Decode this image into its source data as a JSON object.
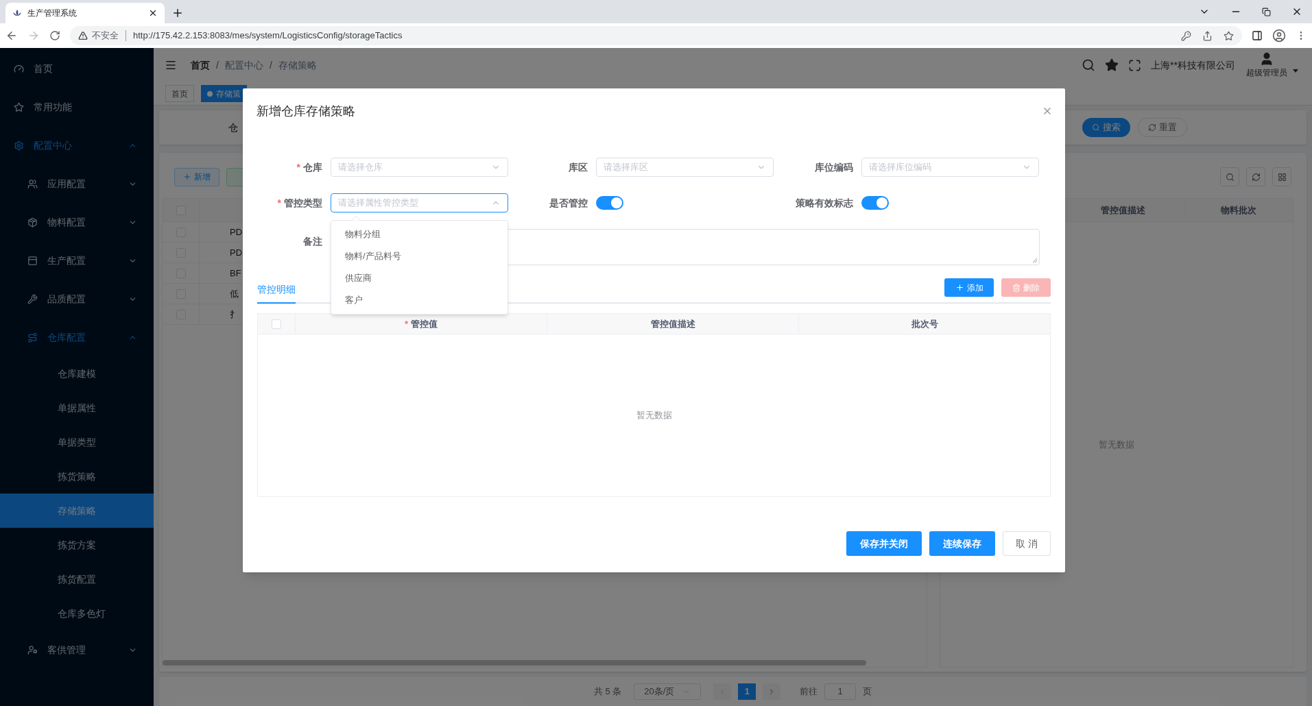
{
  "browser": {
    "tab_title": "生产管理系统",
    "security": "不安全",
    "url": "http://175.42.2.153:8083/mes/system/LogisticsConfig/storageTactics"
  },
  "sidebar": {
    "items": [
      {
        "label": "首页",
        "selected": false
      },
      {
        "label": "常用功能",
        "selected": false
      },
      {
        "label": "配置中心",
        "selected": false,
        "expanded": true,
        "children": [
          {
            "label": "应用配置",
            "selected": false,
            "expanded": false
          },
          {
            "label": "物料配置",
            "selected": false,
            "expanded": false
          },
          {
            "label": "生产配置",
            "selected": false,
            "expanded": false
          },
          {
            "label": "品质配置",
            "selected": false,
            "expanded": false
          },
          {
            "label": "仓库配置",
            "selected": false,
            "expanded": true,
            "children": [
              {
                "label": "仓库建模",
                "selected": false
              },
              {
                "label": "单据属性",
                "selected": false
              },
              {
                "label": "单据类型",
                "selected": false
              },
              {
                "label": "拣货策略",
                "selected": false
              },
              {
                "label": "存储策略",
                "selected": true
              },
              {
                "label": "拣货方案",
                "selected": false
              },
              {
                "label": "拣货配置",
                "selected": false
              },
              {
                "label": "仓库多色灯",
                "selected": false
              }
            ]
          },
          {
            "label": "客供管理",
            "selected": false,
            "expanded": false
          }
        ]
      }
    ]
  },
  "header": {
    "breadcrumb": [
      "首页",
      "配置中心",
      "存储策略"
    ],
    "breadcrumb_separators": [
      "/",
      "/"
    ],
    "company": "上海**科技有限公司",
    "user": "超级管理员"
  },
  "tags": [
    {
      "label": "首页",
      "selected": false
    },
    {
      "label": "存储策",
      "selected": true
    }
  ],
  "search_form": {
    "label": "仓",
    "buttons": [
      "搜索",
      "重置"
    ]
  },
  "toolbar": {
    "add_button": "新增"
  },
  "left_table": {
    "all_checked": false,
    "rows": [
      {
        "checked": false,
        "cell": "PD"
      },
      {
        "checked": false,
        "cell": "PD"
      },
      {
        "checked": false,
        "cell": "BF"
      },
      {
        "checked": false,
        "cell": "低"
      },
      {
        "checked": false,
        "cell": "扌"
      }
    ]
  },
  "right_table": {
    "columns": [
      "管控值描述",
      "物料批次"
    ],
    "empty": "暂无数据"
  },
  "pagination": {
    "total": "共 5 条",
    "page_size": "20条/页",
    "pages": [
      {
        "label": "1",
        "selected": true
      }
    ],
    "goto": "前往",
    "goto_value": "1",
    "unit": "页"
  },
  "dialog": {
    "title": "新增仓库存储策略",
    "required_mark": "*",
    "fields": [
      {
        "kind": "select",
        "label": "仓库",
        "required": true,
        "placeholder": "请选择仓库",
        "open": false
      },
      {
        "kind": "select",
        "label": "库区",
        "required": false,
        "placeholder": "请选择库区",
        "open": false
      },
      {
        "kind": "select",
        "label": "库位编码",
        "required": false,
        "placeholder": "请选择库位编码",
        "open": false
      },
      {
        "kind": "select",
        "label": "管控类型",
        "required": true,
        "placeholder": "请选择属性管控类型",
        "open": true,
        "options": [
          {
            "label": "物料分组",
            "selected": false
          },
          {
            "label": "物料/产品料号",
            "selected": false
          },
          {
            "label": "供应商",
            "selected": false
          },
          {
            "label": "客户",
            "selected": false
          }
        ]
      },
      {
        "kind": "switch",
        "label": "是否管控",
        "required": false,
        "on": true
      },
      {
        "kind": "switch",
        "label": "策略有效标志",
        "required": false,
        "on": true
      },
      {
        "kind": "textarea",
        "label": "备注",
        "required": false
      }
    ],
    "tabs": [
      {
        "label": "管控明细",
        "selected": true
      }
    ],
    "actions": [
      {
        "kind": "add",
        "label": "添加",
        "disabled": false
      },
      {
        "kind": "delete",
        "label": "删除",
        "disabled": true
      }
    ],
    "table": {
      "all_checked": false,
      "columns": [
        {
          "label": "管控值",
          "required": true
        },
        {
          "label": "管控值描述",
          "required": false
        },
        {
          "label": "批次号",
          "required": false
        }
      ],
      "empty": "暂无数据"
    },
    "buttons": [
      {
        "kind": "primary",
        "label": "保存并关闭"
      },
      {
        "kind": "primary",
        "label": "连续保存"
      },
      {
        "kind": "default",
        "label": "取 消"
      }
    ]
  }
}
